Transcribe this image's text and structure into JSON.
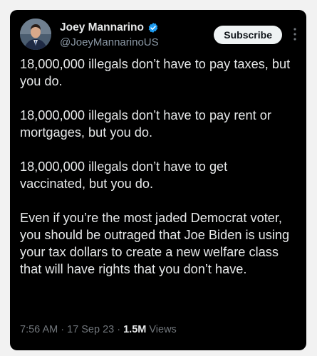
{
  "author": {
    "display_name": "Joey Mannarino",
    "handle": "@JoeyMannarinoUS"
  },
  "header": {
    "subscribe_label": "Subscribe"
  },
  "tweet": {
    "paragraphs": [
      "18,000,000 illegals don’t have to pay taxes, but you do.",
      "18,000,000 illegals don’t have to pay rent or mortgages, but you do.",
      "18,000,000 illegals don’t have to get vaccinated, but you do.",
      "Even if you’re the most jaded Democrat voter, you should be outraged that Joe Biden is using your tax dollars to create a new welfare class that will have rights that you don’t have."
    ]
  },
  "meta": {
    "time": "7:56 AM",
    "sep1": " · ",
    "date": "17 Sep 23",
    "sep2": " · ",
    "views_count": "1.5M",
    "views_label": " Views"
  },
  "colors": {
    "background": "#000000",
    "text_primary": "#e7e9ea",
    "text_secondary": "#71767b",
    "verified_blue": "#1d9bf0",
    "subscribe_bg": "#eff3f4"
  },
  "icons": {
    "verified": "verified-badge-icon",
    "more": "more-options-icon"
  }
}
